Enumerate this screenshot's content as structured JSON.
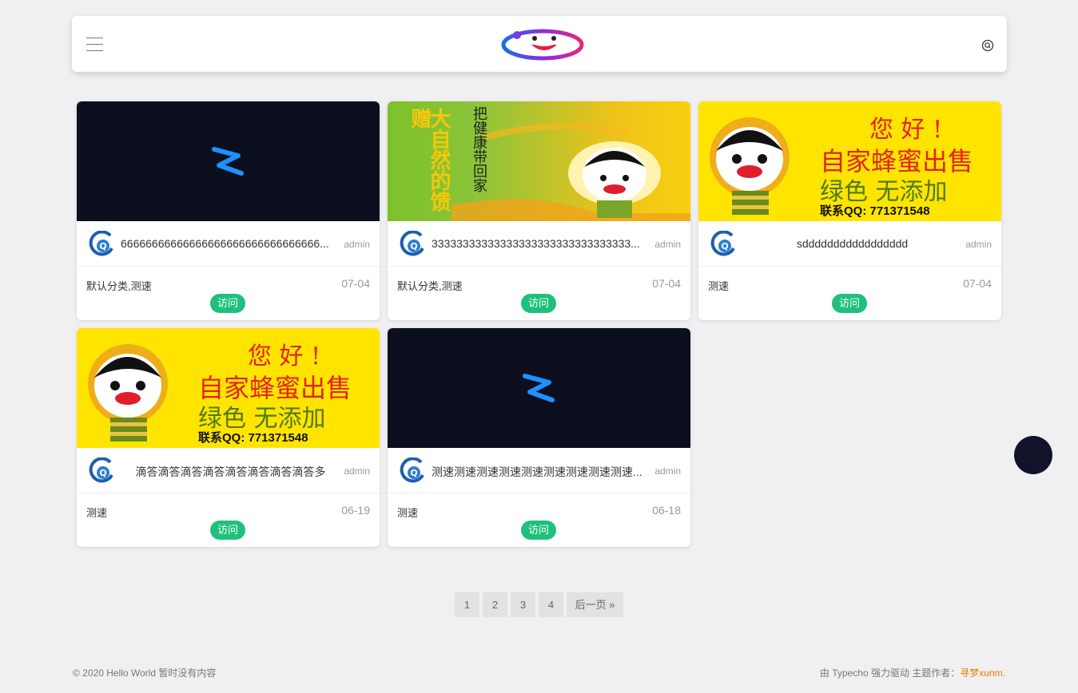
{
  "header": {
    "menu_icon": "hamburger-menu-icon",
    "logo_icon": "smiley-logo-icon",
    "search_icon": "search-icon"
  },
  "cards": [
    {
      "thumb": "dark-brand-image",
      "title": "66666666666666666666666666666666...",
      "author": "admin",
      "category": "默认分类,测速",
      "date": "07-04",
      "button": "访问"
    },
    {
      "thumb": "honey-banner-image",
      "thumb_text": [
        "大自然的馈赠",
        "把健康带回家"
      ],
      "title": "33333333333333333333333333333333...",
      "author": "admin",
      "category": "默认分类,测速",
      "date": "07-04",
      "button": "访问"
    },
    {
      "thumb": "bee-ad-image",
      "thumb_text": [
        "您 好 !",
        "自家蜂蜜出售",
        "绿色 无添加",
        "联系QQ: 771371548"
      ],
      "title": "sddddddddddddddddd",
      "author": "admin",
      "category": "测速",
      "date": "07-04",
      "button": "访问"
    },
    {
      "thumb": "bee-ad-image",
      "thumb_text": [
        "您 好 !",
        "自家蜂蜜出售",
        "绿色 无添加",
        "联系QQ: 771371548"
      ],
      "title": "滴答滴答滴答滴答滴答滴答滴答滴答多",
      "author": "admin",
      "category": "测速",
      "date": "06-19",
      "button": "访问"
    },
    {
      "thumb": "dark-brand-image",
      "title": "测速测速测速测速测速测速测速测速测速...",
      "author": "admin",
      "category": "测速",
      "date": "06-18",
      "button": "访问"
    }
  ],
  "pagination": {
    "pages": [
      "1",
      "2",
      "3",
      "4"
    ],
    "next": "后一页 »"
  },
  "footer": {
    "left": "© 2020 Hello World 暂时没有内容",
    "right_prefix": "由 Typecho 强力驱动 主题作者：",
    "right_author": "寻梦xunm",
    "right_suffix": "."
  },
  "colors": {
    "visit_button": "#1fc07b",
    "author_link": "#e67e00",
    "float_button": "#12132b"
  }
}
